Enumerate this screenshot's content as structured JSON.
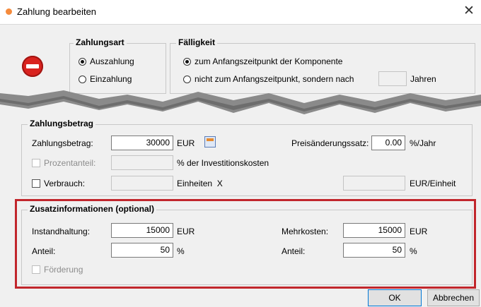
{
  "window": {
    "title": "Zahlung bearbeiten",
    "close": "✕"
  },
  "art": {
    "label": "Zahlungsart",
    "options": [
      "Auszahlung",
      "Einzahlung"
    ],
    "selected": "Auszahlung"
  },
  "faelligkeit": {
    "label": "Fälligkeit",
    "options": [
      "zum Anfangszeitpunkt der Komponente",
      "nicht zum Anfangszeitpunkt, sondern nach"
    ],
    "selected": "zum Anfangszeitpunkt der Komponente",
    "years_value": "",
    "years_unit": "Jahren"
  },
  "betrag": {
    "group_label": "Zahlungsbetrag",
    "amount_label": "Zahlungsbetrag:",
    "amount_value": "30000",
    "currency": "EUR",
    "rate_label": "Preisänderungssatz:",
    "rate_value": "0.00",
    "rate_unit": "%/Jahr",
    "percent_label": "Prozentanteil:",
    "percent_value": "",
    "percent_suffix": "% der Investitionskosten",
    "verbrauch_label": "Verbrauch:",
    "verbrauch_value": "",
    "einheiten_label": "Einheiten  X",
    "per_unit_value": "",
    "per_unit_label": "EUR/Einheit"
  },
  "zusatz": {
    "group_label": "Zusatzinformationen (optional)",
    "instandhaltung_label": "Instandhaltung:",
    "instandhaltung_value": "15000",
    "instandhaltung_unit": "EUR",
    "mehrkosten_label": "Mehrkosten:",
    "mehrkosten_value": "15000",
    "mehrkosten_unit": "EUR",
    "anteil_left_label": "Anteil:",
    "anteil_left_value": "50",
    "anteil_left_unit": "%",
    "anteil_right_label": "Anteil:",
    "anteil_right_value": "50",
    "anteil_right_unit": "%",
    "foerderung_label": "Förderung"
  },
  "buttons": {
    "ok": "OK",
    "cancel": "Abbrechen"
  },
  "colors": {
    "highlight": "#c1262c",
    "stop_icon": "#d9231f",
    "title_dot": "#f58b3c"
  }
}
